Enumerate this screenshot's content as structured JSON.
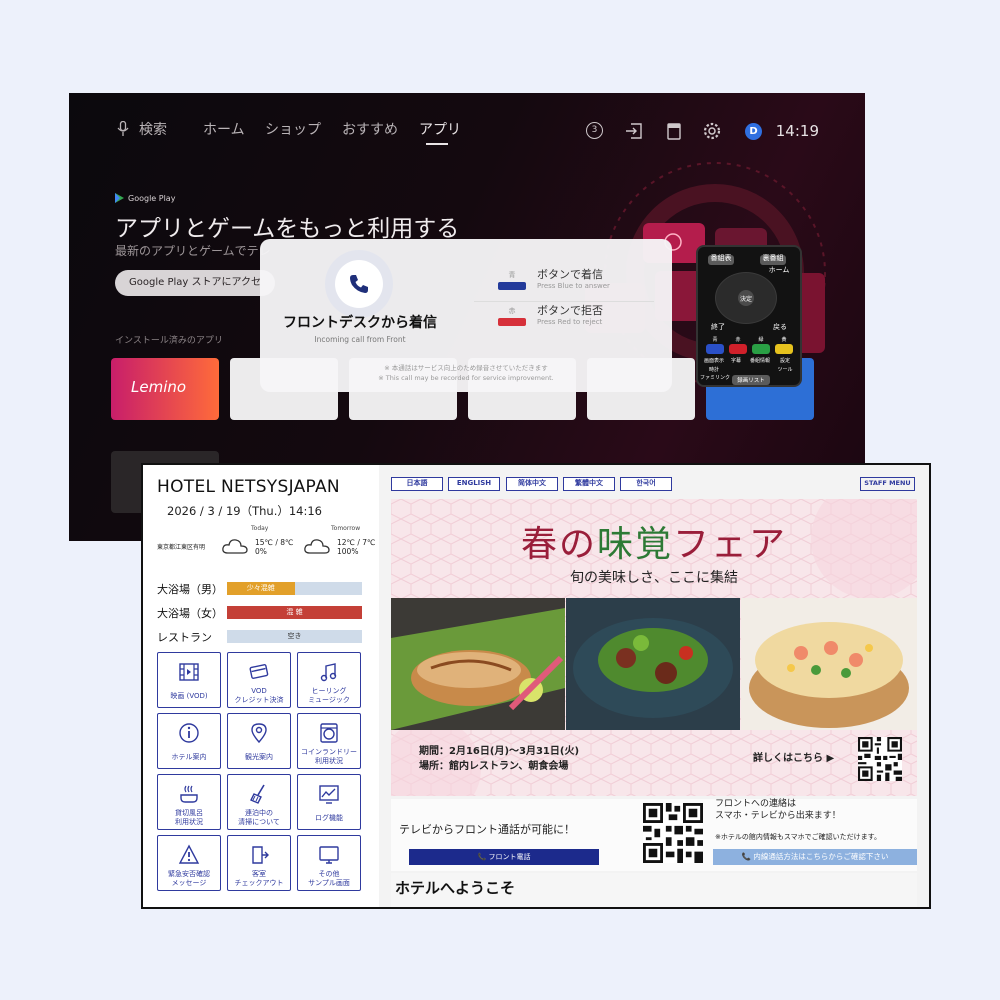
{
  "tv": {
    "nav": {
      "search": "検索",
      "home": "ホーム",
      "shop": "ショップ",
      "recommended": "おすすめ",
      "apps": "アプリ"
    },
    "notifications": "3",
    "avatar_initial": "D",
    "clock": "14:19",
    "google_play": "Google Play",
    "headline": "アプリとゲームをもっと利用する",
    "subline": "最新のアプリとゲームでテレ",
    "store_button": "Google Play ストアにアクセ",
    "installed_label": "インストール済みのアプリ",
    "app_tile_1": "Lemino",
    "call_popup": {
      "title": "フロントデスクから着信",
      "subtitle": "Incoming call from Front",
      "blue_chip": "青",
      "blue_label": "ボタンで着信",
      "blue_sub": "Press Blue to answer",
      "red_chip": "赤",
      "red_label": "ボタンで拒否",
      "red_sub": "Press Red to reject",
      "note_jp": "※ 本通話はサービス向上のため録音させていただきます",
      "note_en": "※ This call may be recorded for service improvement."
    },
    "remote": {
      "program_guide": "番組表",
      "data_broadcast": "裏番組",
      "home": "ホーム",
      "enter": "決定",
      "exit": "終了",
      "back": "戻る",
      "blue": "青",
      "red": "赤",
      "green": "緑",
      "yellow": "黄",
      "display": "画面表示",
      "subtitle": "字幕",
      "program_info": "番組情報",
      "settings": "設定",
      "clock": "時計",
      "tools": "ツール",
      "family": "ファミリンク",
      "recordings": "録画リスト"
    }
  },
  "hotel": {
    "name": "HOTEL NETSYSJAPAN",
    "date_time": "2026 / 3 / 19（Thu.）14:16",
    "location": "東京都江東区有明",
    "today_label": "Today",
    "today_temp": "15℃ / 8℃",
    "today_pct": "0%",
    "tomorrow_label": "Tomorrow",
    "tomorrow_temp": "12℃ / 7℃",
    "tomorrow_pct": "100%",
    "status": [
      {
        "label": "大浴場（男）",
        "value": "少々混雑",
        "color": "#e2a02a",
        "fill": 0.5
      },
      {
        "label": "大浴場（女）",
        "value": "混 雑",
        "color": "#c44037",
        "fill": 1.0
      },
      {
        "label": "レストラン",
        "value": "空き",
        "color": "#cfdbe9",
        "fill": 0.0
      }
    ],
    "menu": [
      {
        "icon": "film-icon",
        "label": "映画 (VOD)"
      },
      {
        "icon": "credit-card-icon",
        "label1": "VOD",
        "label2": "クレジット決済"
      },
      {
        "icon": "music-note-icon",
        "label1": "ヒーリング",
        "label2": "ミュージック"
      },
      {
        "icon": "info-icon",
        "label": "ホテル案内"
      },
      {
        "icon": "map-pin-icon",
        "label": "観光案内"
      },
      {
        "icon": "washing-machine-icon",
        "label1": "コインランドリー",
        "label2": "利用状況"
      },
      {
        "icon": "bath-icon",
        "label1": "貸切風呂",
        "label2": "利用状況"
      },
      {
        "icon": "broom-icon",
        "label1": "連泊中の",
        "label2": "清掃について"
      },
      {
        "icon": "chart-icon",
        "label": "ログ機能"
      },
      {
        "icon": "warning-icon",
        "label1": "緊急安否確認",
        "label2": "メッセージ"
      },
      {
        "icon": "door-exit-icon",
        "label1": "客室",
        "label2": "チェックアウト"
      },
      {
        "icon": "tv-icon",
        "label1": "その他",
        "label2": "サンプル画面"
      }
    ],
    "languages": [
      "日本語",
      "ENGLISH",
      "简体中文",
      "繁體中文",
      "한국어"
    ],
    "staff_menu": "STAFF MENU",
    "banner": {
      "title_a": "春の",
      "title_b": "味覚",
      "title_c": "フェア",
      "subtitle": "旬の美味しさ、ここに集結",
      "period": "期間：2月16日(月)～3月31日(火)",
      "place": "場所：館内レストラン、朝食会場",
      "more": "詳しくはこちら ▶"
    },
    "tv_call_text": "テレビからフロント通話が可能に！",
    "front_call_button": "📞 フロント電話",
    "contact_line1": "フロントへの連絡は",
    "contact_line2": "スマホ・テレビから出来ます！",
    "contact_note": "※ホテルの館内情報もスマホでご確認いただけます。",
    "inline_button": "📞 内線通話方法はこちらからご確認下さい",
    "welcome": "ホテルへようこそ",
    "colors": {
      "accent": "#2f3a9e",
      "title_red": "#9a1e3a",
      "title_green": "#2d7a35"
    }
  }
}
